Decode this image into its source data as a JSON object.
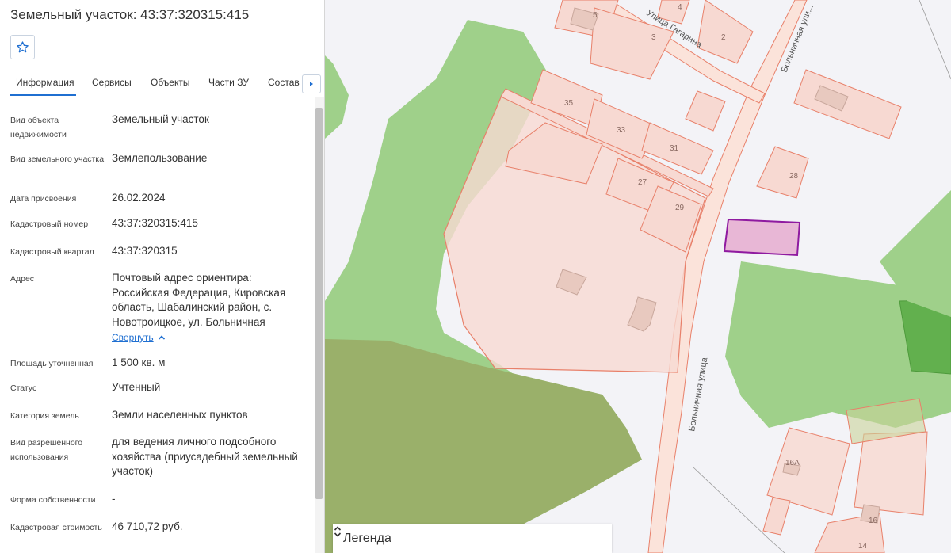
{
  "panel": {
    "title": "Земельный участок: 43:37:320315:415",
    "tabs": [
      "Информация",
      "Сервисы",
      "Объекты",
      "Части ЗУ",
      "Состав"
    ],
    "active_tab": "Информация",
    "fields": [
      {
        "label": "Вид объекта недвижимости",
        "value": "Земельный участок"
      },
      {
        "label": "Вид земельного участка",
        "value": "Землепользование"
      },
      {
        "label": "Дата присвоения",
        "value": "26.02.2024"
      },
      {
        "label": "Кадастровый номер",
        "value": "43:37:320315:415"
      },
      {
        "label": "Кадастровый квартал",
        "value": "43:37:320315"
      },
      {
        "label": "Адрес",
        "value": "Почтовый адрес ориентира: Российская Федерация, Кировская область, Шабалинский район, с. Новотроицкое, ул. Больничная"
      },
      {
        "label": "Площадь уточненная",
        "value": "1 500 кв. м"
      },
      {
        "label": "Статус",
        "value": "Учтенный"
      },
      {
        "label": "Категория земель",
        "value": "Земли населенных пунктов"
      },
      {
        "label": "Вид разрешенного использования",
        "value": "для ведения личного подсобного хозяйства (приусадебный земельный участок)"
      },
      {
        "label": "Форма собственности",
        "value": "-"
      },
      {
        "label": "Кадастровая стоимость",
        "value": "46 710,72 руб."
      }
    ],
    "collapse_link": "Свернуть"
  },
  "map": {
    "street_labels": [
      "Улица Гагарина",
      "Больничная улица",
      "Больничная ули..."
    ],
    "house_numbers": [
      "5",
      "4",
      "3",
      "2",
      "35",
      "33",
      "31",
      "28",
      "27",
      "29",
      "16А",
      "16",
      "14"
    ],
    "legend_label": "Легенда",
    "colors": {
      "map_background": "#f3f3f7",
      "green_area": "#9fd08a",
      "parcel_fill": "#f7d9d2",
      "parcel_stroke": "#e8806a",
      "selected_fill": "#e8b7d6",
      "selected_stroke": "#8f1aa0",
      "road_fill": "#fbe3da"
    }
  }
}
